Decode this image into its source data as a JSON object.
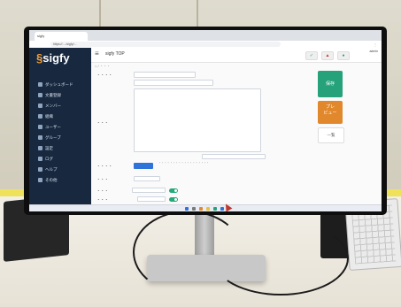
{
  "browser": {
    "tab_label": "sigfy",
    "url": "https://..../sigfy/..."
  },
  "app": {
    "logo_text": "sigfy",
    "brand_color": "#f0a23b",
    "sidebar_color": "#17283f",
    "top_title": "sigfy TOP",
    "user_label": "admin"
  },
  "sidebar": {
    "items": [
      {
        "label": "ダッシュボード",
        "icon": "dashboard-icon"
      },
      {
        "label": "文書登録",
        "icon": "document-icon"
      },
      {
        "label": "メンバー",
        "icon": "members-icon"
      },
      {
        "label": "組織",
        "icon": "org-icon"
      },
      {
        "label": "ユーザー",
        "icon": "user-icon"
      },
      {
        "label": "グループ",
        "icon": "group-icon"
      },
      {
        "label": "設定",
        "icon": "settings-icon"
      },
      {
        "label": "ログ",
        "icon": "log-icon"
      },
      {
        "label": "ヘルプ",
        "icon": "help-icon"
      },
      {
        "label": "その他",
        "icon": "more-icon"
      }
    ]
  },
  "actions": {
    "save": "保存",
    "preview_line1": "プレ",
    "preview_line2": "ビュー",
    "list": "一覧",
    "save_color": "#26a27a",
    "preview_color": "#e1882d"
  },
  "environment": {
    "wall_color": "#dcd8ca",
    "table_color": "#f0ece3",
    "skirt_color": "#efe25a"
  }
}
